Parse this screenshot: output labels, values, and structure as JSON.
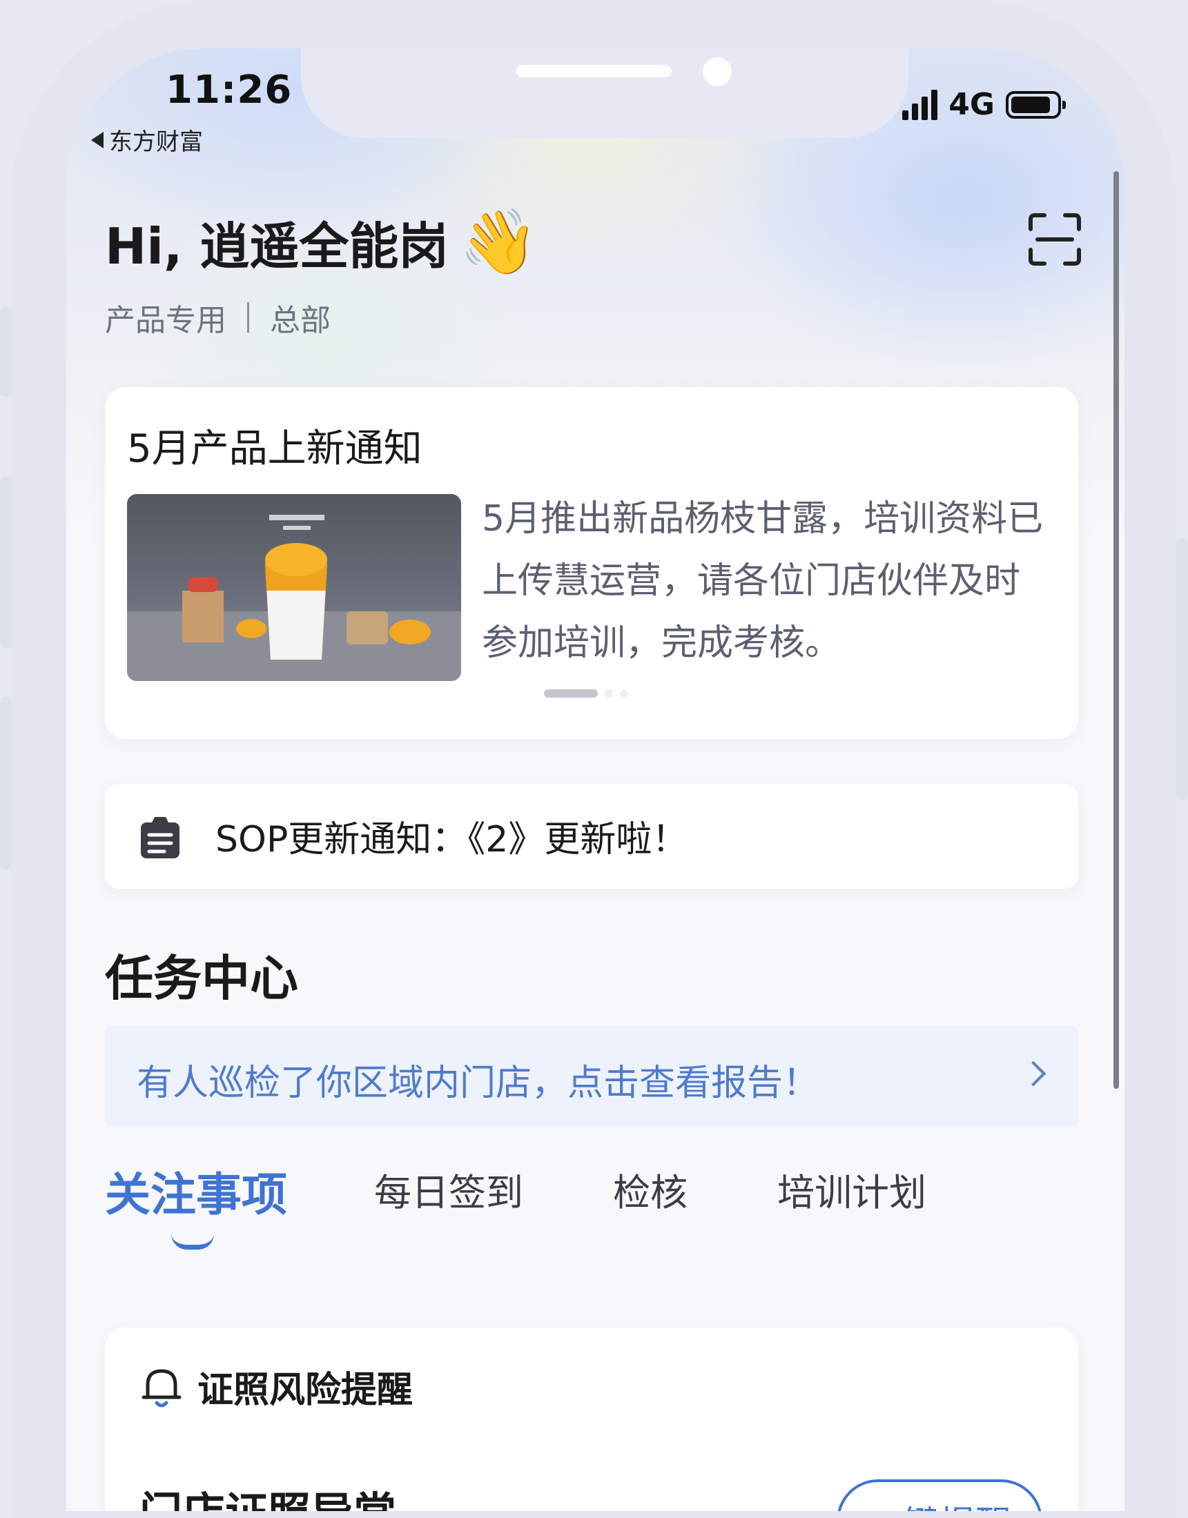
{
  "status_bar": {
    "time": "11:26",
    "back_app": "东方财富",
    "network": "4G",
    "signal_icon": "cellular-signal-icon",
    "battery_icon": "battery-icon"
  },
  "header": {
    "greeting": "Hi, 逍遥全能岗",
    "wave_emoji": "👋",
    "role": "产品专用",
    "department": "总部",
    "scan_icon": "scan-icon"
  },
  "notice": {
    "title": "5月产品上新通知",
    "body": "5月推出新品杨枝甘露，培训资料已上传慧运营，请各位门店伙伴及时参加培训，完成考核。",
    "image_icon": "product-image"
  },
  "sop": {
    "icon": "clipboard-icon",
    "text": "SOP更新通知：《2》更新啦！"
  },
  "task_center": {
    "title": "任务中心",
    "alert_text": "有人巡检了你区域内门店，点击查看报告！",
    "alert_arrow_icon": "chevron-right-icon"
  },
  "tabs": [
    {
      "label": "关注事项",
      "active": true
    },
    {
      "label": "每日签到",
      "active": false
    },
    {
      "label": "检核",
      "active": false
    },
    {
      "label": "培训计划",
      "active": false
    }
  ],
  "license": {
    "header": "证照风险提醒",
    "bell_icon": "bell-icon",
    "row_title": "门店证照异常",
    "remind_button": "一键提醒"
  },
  "colors": {
    "accent": "#3f73d3",
    "alert_text": "#4f7bcb",
    "alert_bg": "#edf2fd",
    "page_bg": "#f7f8fa"
  }
}
